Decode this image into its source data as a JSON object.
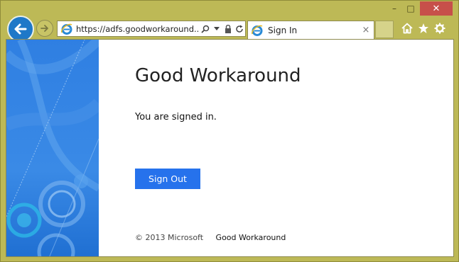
{
  "window": {
    "minimize_glyph": "–",
    "maximize_glyph": "□",
    "close_glyph": "✕"
  },
  "browser": {
    "address": {
      "url": "https://adfs.goodworkaround...",
      "icons": [
        "search-icon",
        "dropdown-icon",
        "lock-icon",
        "refresh-icon"
      ]
    },
    "tab": {
      "title": "Sign In",
      "close_glyph": "×"
    },
    "tools": [
      "home-icon",
      "favorites-icon",
      "settings-icon"
    ]
  },
  "page": {
    "site_title": "Good Workaround",
    "status_message": "You are signed in.",
    "sign_out_label": "Sign Out",
    "footer": {
      "copyright": "© 2013 Microsoft",
      "link": "Good Workaround"
    }
  },
  "colors": {
    "frame": "#bdb956",
    "accent": "#2672ec",
    "back_button": "#1e78c8",
    "close_button": "#c7504a"
  }
}
